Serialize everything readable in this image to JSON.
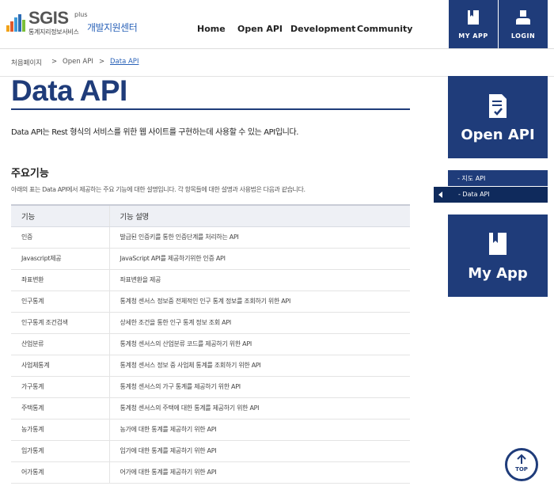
{
  "header": {
    "logo_main": "SGIS",
    "logo_plus": "plus",
    "logo_sub": "통계지리정보서비스",
    "logo_center": "개발지원센터",
    "nav": [
      "Home",
      "Open API",
      "Development",
      "Community"
    ],
    "my_app_label": "MY APP",
    "login_label": "LOGIN"
  },
  "breadcrumb": {
    "home": "처음페이지",
    "sep": ">",
    "level1": "Open API",
    "current": "Data API"
  },
  "main": {
    "title": "Data API",
    "description": "Data API는 Rest 형식의 서비스를 위한 웹 사이트를 구현하는데 사용할 수 있는 API입니다.",
    "section_title": "주요기능",
    "section_desc": "아래의 표는 Data API에서 제공하는 주요 기능에 대한 설명입니다. 각 항목들에 대한 설명과 사용법은 다음과 같습니다.",
    "table": {
      "headers": [
        "기능",
        "기능 설명"
      ],
      "rows": [
        [
          "인증",
          "발급된 인증키를 통한 인증단계를 처리하는 API"
        ],
        [
          "Javascript제공",
          "JavaScript API를 제공하기위한 인증 API"
        ],
        [
          "좌표변환",
          "좌표변환을 제공"
        ],
        [
          "인구통계",
          "통계청 센서스 정보중 전체적인 인구 통계 정보를 조회하기 위한 API"
        ],
        [
          "인구통계 조건검색",
          "상세한 조건을 통한 인구 통계 정보 조회 API"
        ],
        [
          "산업분류",
          "통계청 센서스의 산업분류 코드를 제공하기 위한 API"
        ],
        [
          "사업체통계",
          "통계청 센서스 정보 중 사업체 통계를 조회하기 위한 API"
        ],
        [
          "가구통계",
          "통계청 센서스의 가구 통계를 제공하기 위한 API"
        ],
        [
          "주택통계",
          "통계청 센서스의 주택에 대한 통계를 제공하기 위한 API"
        ],
        [
          "농가통계",
          "농가에 대한 통계를 제공하기 위한 API"
        ],
        [
          "임가통계",
          "임가에 대한 통계를 제공하기 위한 API"
        ],
        [
          "어가통계",
          "어가에 대한 통계를 제공하기 위한 API"
        ]
      ]
    }
  },
  "sidebar": {
    "open_api_label": "Open API",
    "submenu": [
      "- 지도 API",
      "- Data API"
    ],
    "my_app_label": "My App"
  },
  "top_button_label": "TOP",
  "colors": {
    "brand_navy": "#1f3c7a",
    "link_blue": "#2a62b8"
  }
}
